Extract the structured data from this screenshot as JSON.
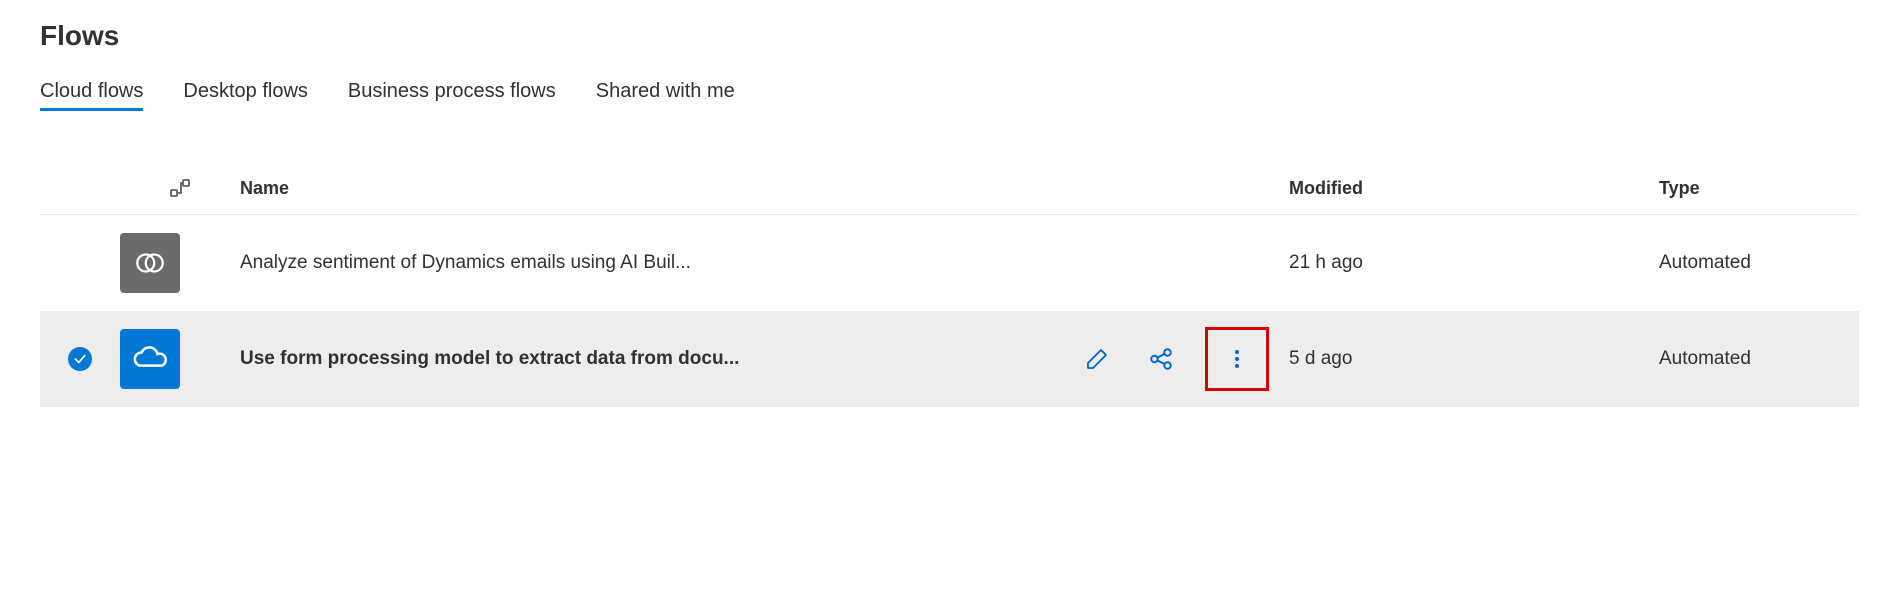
{
  "page": {
    "title": "Flows"
  },
  "tabs": [
    {
      "label": "Cloud flows",
      "active": true
    },
    {
      "label": "Desktop flows",
      "active": false
    },
    {
      "label": "Business process flows",
      "active": false
    },
    {
      "label": "Shared with me",
      "active": false
    }
  ],
  "columns": {
    "name": "Name",
    "modified": "Modified",
    "type": "Type"
  },
  "rows": [
    {
      "selected": false,
      "icon": "dynamics-icon",
      "iconColor": "gray",
      "name": "Analyze sentiment of Dynamics emails using AI Buil...",
      "modified": "21 h ago",
      "type": "Automated",
      "showActions": false
    },
    {
      "selected": true,
      "icon": "onedrive-icon",
      "iconColor": "blue",
      "name": "Use form processing model to extract data from docu...",
      "modified": "5 d ago",
      "type": "Automated",
      "showActions": true
    }
  ],
  "actions": {
    "edit": "Edit",
    "share": "Share",
    "more": "More commands"
  }
}
